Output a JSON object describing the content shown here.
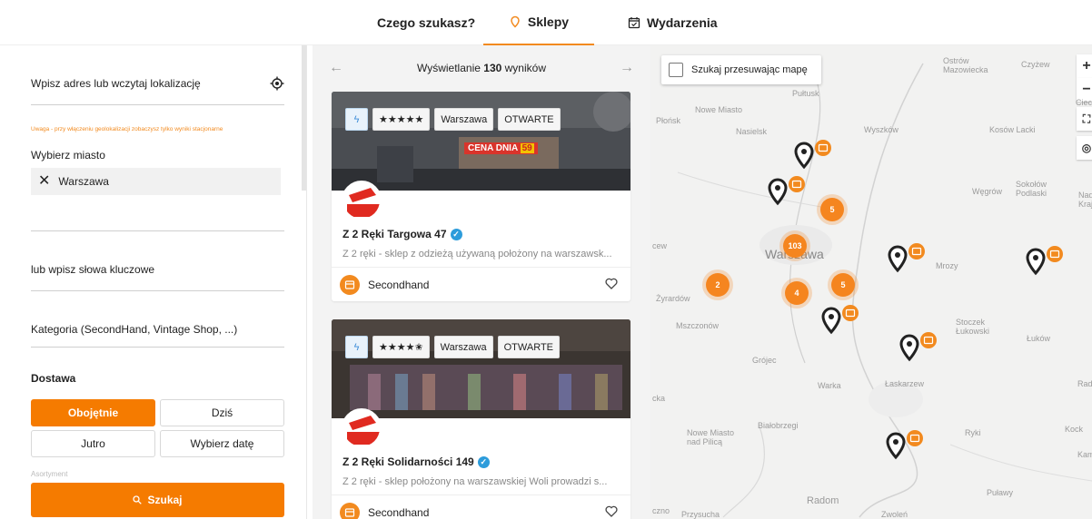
{
  "nav": {
    "what": "Czego szukasz?",
    "shops": "Sklepy",
    "events": "Wydarzenia"
  },
  "filters": {
    "address_placeholder": "Wpisz adres lub wczytaj lokalizację",
    "warning": "Uwaga - przy włączeniu geolokalizacji zobaczysz tylko wyniki stacjonarne",
    "city_label": "Wybierz miasto",
    "city_value": "Warszawa",
    "keywords_placeholder": "lub wpisz słowa kluczowe",
    "category_placeholder": "Kategoria (SecondHand, Vintage Shop, ...)",
    "delivery_label": "Dostawa",
    "delivery_options": [
      "Obojętnie",
      "Dziś",
      "Jutro",
      "Wybierz datę"
    ],
    "delivery_selected": "Obojętnie",
    "faded_label": "Asortyment",
    "search_button": "Szukaj"
  },
  "results": {
    "prefix": "Wyświetlanie",
    "count": "130",
    "suffix": "wyników",
    "cards": [
      {
        "stars": "★★★★★",
        "city": "Warszawa",
        "status": "OTWARTE",
        "name": "Z 2 Ręki Targowa 47",
        "description": "Z 2 ręki - sklep z odzieżą używaną położony na warszawsk...",
        "category": "Secondhand",
        "sign_text": "CENA DNIA",
        "sign_price": "59"
      },
      {
        "stars": "★★★★✬",
        "city": "Warszawa",
        "status": "OTWARTE",
        "name": "Z 2 Ręki Solidarności 149",
        "description": "Z 2 ręki - sklep położony na warszawskiej Woli prowadzi s...",
        "category": "Secondhand"
      }
    ]
  },
  "map": {
    "search_on_move": "Szukaj przesuwając mapę",
    "zoom_in": "+",
    "zoom_out": "−",
    "clusters": [
      "103",
      "5",
      "5",
      "4",
      "2"
    ],
    "cities": {
      "warszawa": "Warszawa",
      "nowe_miasto": "Nowe Miasto",
      "plonsk": "Płońsk",
      "nasielsk": "Nasielsk",
      "pultusk": "Pułtusk",
      "wyszkow": "Wyszków",
      "ostrow": "Ostrów Mazowiecka",
      "czyzew": "Czyżew",
      "ciechanowiec": "Ciechanowiec",
      "kosow": "Kosów Lacki",
      "wegrow": "Węgrów",
      "sokolow": "Sokołów Podlaski",
      "nadbuzanski": "Nadbuż. Kraj.",
      "mrozy": "Mrozy",
      "zyrardow": "Żyrardów",
      "mszczonow": "Mszczonów",
      "grojec": "Grójec",
      "warka": "Warka",
      "laskarzew": "Łaskarzew",
      "stoczek": "Stoczek Łukowski",
      "lukow": "Łuków",
      "radz": "Radz.",
      "bialobrzegi": "Białobrzegi",
      "nowe_miasto_pilica": "Nowe Miasto nad Pilicą",
      "ryki": "Ryki",
      "kock": "Kock",
      "kamionka": "Kamionka",
      "pulawy": "Puławy",
      "radom": "Radom",
      "przysucha": "Przysucha",
      "zwolen": "Zwoleń",
      "cew": "cew",
      "cka": "cka",
      "czno": "czno"
    },
    "colors": {
      "accent": "#f57b00",
      "cluster": "#f5851f",
      "pin": "#222222"
    }
  }
}
